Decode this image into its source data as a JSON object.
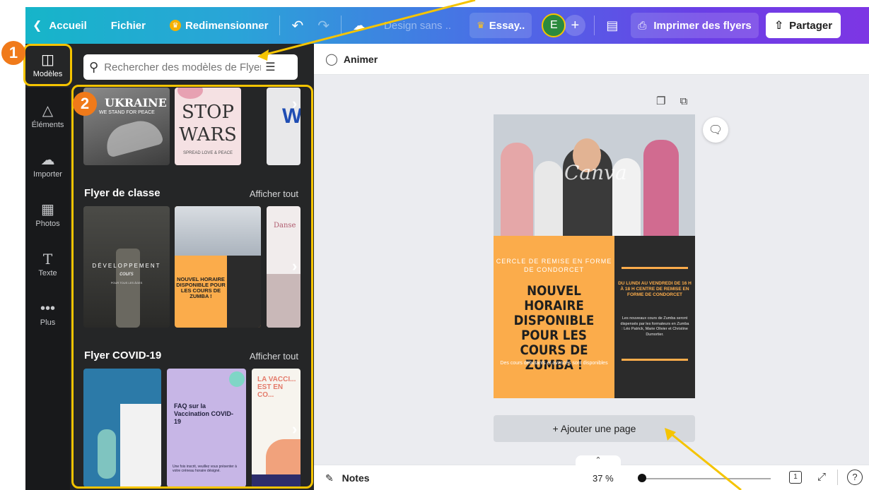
{
  "topbar": {
    "back_label": "Accueil",
    "file_label": "Fichier",
    "resize_label": "Redimensionner",
    "design_title": "Design sans ..",
    "essay_label": "Essay..",
    "avatar_initial": "E",
    "print_label": "Imprimer des flyers",
    "share_label": "Partager"
  },
  "rail": {
    "items": [
      {
        "label": "Modèles",
        "icon": "layout-icon"
      },
      {
        "label": "Éléments",
        "icon": "shapes-icon"
      },
      {
        "label": "Importer",
        "icon": "cloud-upload-icon"
      },
      {
        "label": "Photos",
        "icon": "image-icon"
      },
      {
        "label": "Texte",
        "icon": "text-icon"
      },
      {
        "label": "Plus",
        "icon": "more-icon"
      }
    ]
  },
  "panel": {
    "search_placeholder": "Rechercher des modèles de Flyer",
    "sections": [
      {
        "title": "Flyer de classe",
        "show_all": "Afficher tout"
      },
      {
        "title": "Flyer COVID-19",
        "show_all": "Afficher tout"
      }
    ],
    "thumbs": {
      "ukraine_title": "UKRAINE",
      "ukraine_sub": "WE STAND FOR PEACE",
      "stop_l1": "STOP",
      "stop_l2": "WARS",
      "stop_sub": "SPREAD LOVE & PEACE",
      "dev_title": "DÉVELOPPEMENT",
      "dev_sub": "cours",
      "dev_small": "POUR TOUS LES ÂGES",
      "zumba_small_title": "NOUVEL HORAIRE DISPONIBLE POUR LES COURS DE ZUMBA !",
      "faq_title": "FAQ sur la Vaccination COVID-19",
      "faq_bottom": "Une fois inscrit, veuillez vous présenter à votre créneau horaire désigné.",
      "vacc_title": "LA VACCI... EST EN CO..."
    }
  },
  "workspace": {
    "animate_label": "Animer",
    "add_page_label": "+ Ajouter une page",
    "notes_label": "Notes",
    "zoom": "37 %",
    "zoom_fraction": 0.0,
    "page_count": "1"
  },
  "flyer": {
    "watermark": "Canva",
    "subtitle": "CERCLE DE REMISE EN FORME DE CONDORCET",
    "title": "NOUVEL HORAIRE DISPONIBLE POUR LES COURS DE ZUMBA !",
    "small": "Des cours débutants et avancés sont disponibles",
    "right_title": "DU LUNDI AU VENDREDI DE 16 H À 18 H CENTRE DE REMISE EN FORME DE CONDORCET",
    "right_body": "Les nouveaux cours de Zumba seront dispensés par les formateurs en Zumba : Léo Patrick, Marie Olivier et Christine Dumortier."
  },
  "annotations": {
    "badge_1": "1",
    "badge_2": "2"
  },
  "colors": {
    "highlight": "#f5c400",
    "badge": "#f07a1a",
    "flyer_orange": "#fbac4b",
    "flyer_dark": "#2b2b2b",
    "panel_bg": "#252627",
    "rail_bg": "#18191b"
  }
}
